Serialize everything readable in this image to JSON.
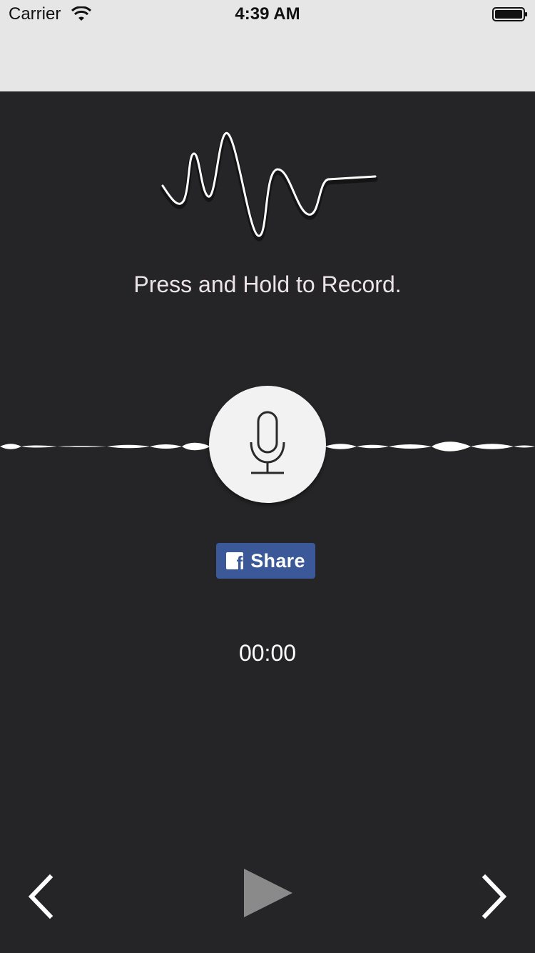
{
  "status_bar": {
    "carrier": "Carrier",
    "time": "4:39 AM",
    "wifi_icon": "wifi-icon",
    "battery_icon": "battery-icon"
  },
  "main": {
    "hero_icon": "sound-wave-icon",
    "instruction": "Press and Hold to Record.",
    "record_button_icon": "microphone-icon",
    "share_button": {
      "label": "Share",
      "icon": "facebook-icon",
      "background": "#3b5998"
    },
    "timer": "00:00"
  },
  "controls": {
    "prev_icon": "chevron-left-icon",
    "play_icon": "play-icon",
    "next_icon": "chevron-right-icon"
  },
  "colors": {
    "background": "#252527",
    "status_bar_background": "#e6e6e6",
    "text": "#ffffff",
    "play_disabled": "#8a8a8a"
  }
}
